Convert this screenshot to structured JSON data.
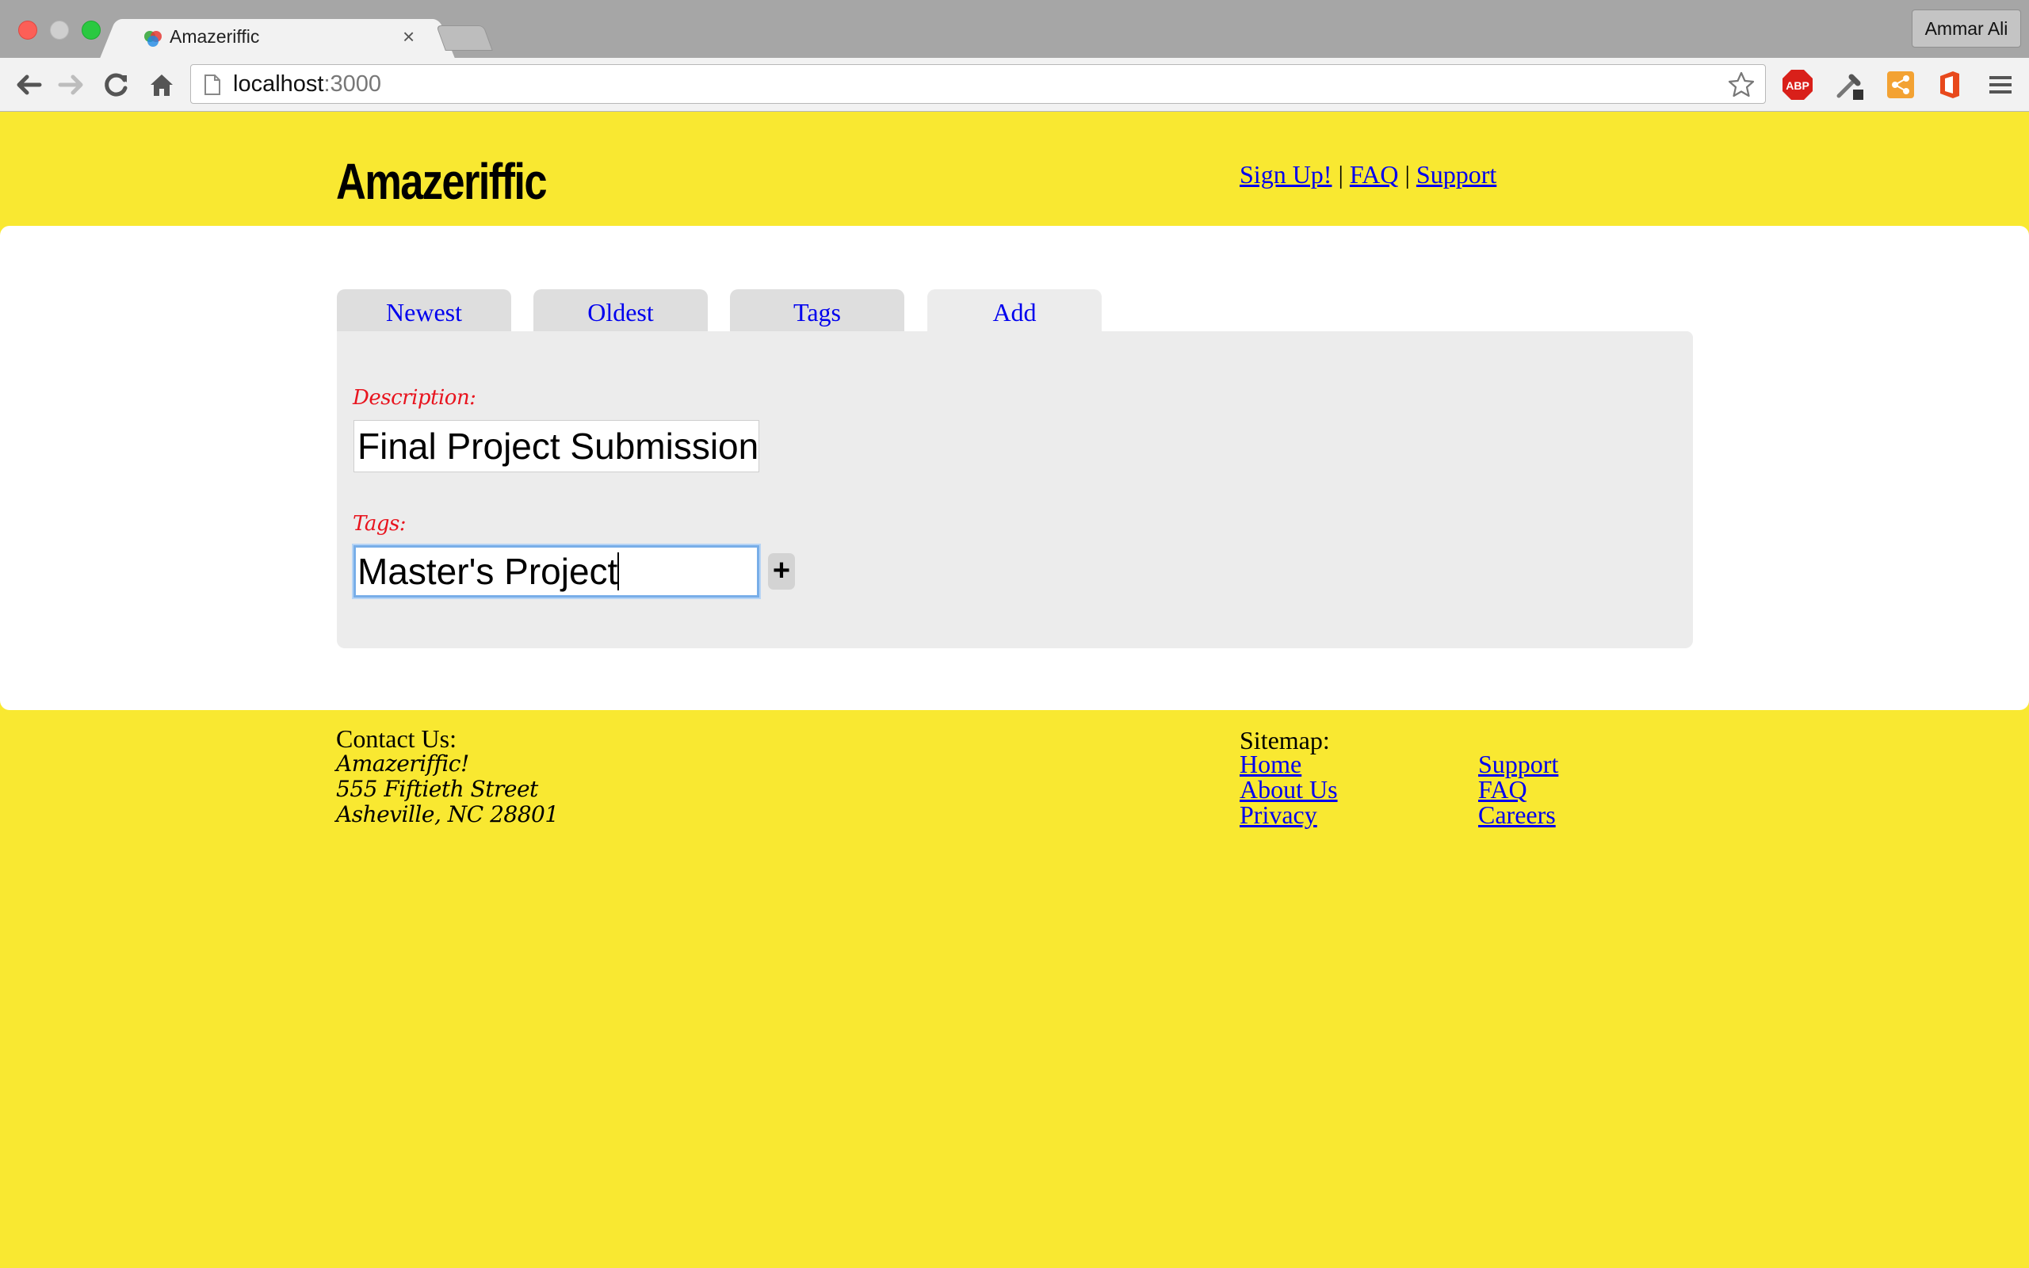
{
  "browser": {
    "tab_title": "Amazeriffic",
    "tab_close": "×",
    "profile_name": "Ammar Ali",
    "url_host": "localhost",
    "url_port": ":3000",
    "abp_label": "ABP"
  },
  "header": {
    "brand": "Amazeriffic",
    "nav": {
      "signup": "Sign Up!",
      "sep1": "|",
      "faq": "FAQ",
      "sep2": "|",
      "support": "Support"
    }
  },
  "tabs": [
    {
      "label": "Newest"
    },
    {
      "label": "Oldest"
    },
    {
      "label": "Tags"
    },
    {
      "label": "Add"
    }
  ],
  "form": {
    "description_label": "Description:",
    "description_value": "Final Project Submission",
    "tags_label": "Tags:",
    "tags_value": "Master's Project",
    "add_button": "+"
  },
  "footer": {
    "contact_title": "Contact Us:",
    "contact_lines": [
      "Amazeriffic!",
      "555 Fiftieth Street",
      "Asheville, NC 28801"
    ],
    "sitemap_title": "Sitemap:",
    "sitemap_col1": [
      "Home",
      "About Us",
      "Privacy"
    ],
    "sitemap_col2": [
      "Support",
      "FAQ",
      "Careers"
    ]
  }
}
